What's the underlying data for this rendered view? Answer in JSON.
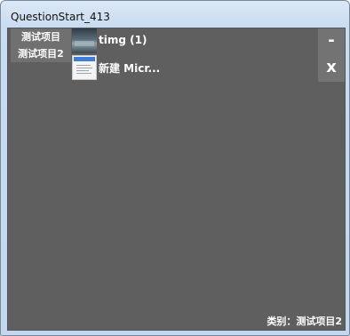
{
  "window": {
    "title": "QuestionStart_413"
  },
  "categories": [
    {
      "label": "测试项目"
    },
    {
      "label": "测试项目2"
    }
  ],
  "files": [
    {
      "name": "timg (1)",
      "icon": "photo-thumbnail-icon"
    },
    {
      "name": "新建 Micr...",
      "icon": "word-document-icon"
    }
  ],
  "side_buttons": {
    "minimize_label": "-",
    "close_label": "x"
  },
  "footer": {
    "category_text": "类别：测试项目2"
  },
  "colors": {
    "panel_background": "#5f5f5f",
    "category_list_background": "#707070",
    "side_buttons_background": "#737373",
    "text": "#ffffff"
  }
}
